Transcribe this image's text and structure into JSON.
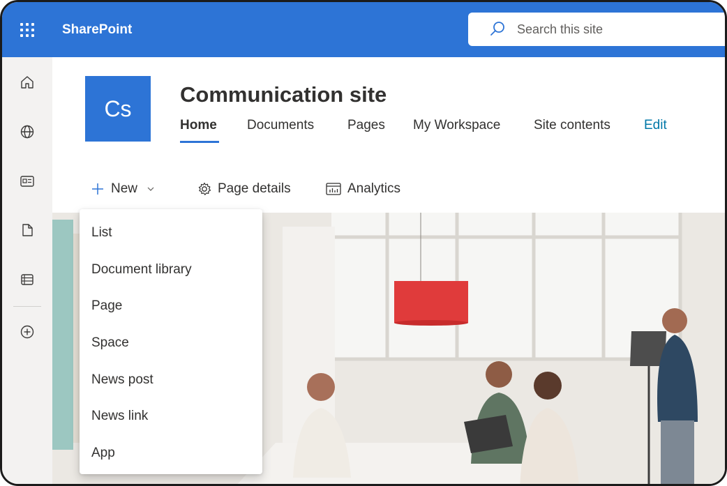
{
  "suitebar": {
    "app_name": "SharePoint",
    "search_placeholder": "Search this site",
    "color": "#2d74d6"
  },
  "rail": {
    "items": [
      {
        "icon": "home-icon"
      },
      {
        "icon": "globe-icon"
      },
      {
        "icon": "news-icon"
      },
      {
        "icon": "document-icon"
      },
      {
        "icon": "lists-icon"
      },
      {
        "icon": "add-circle-icon"
      }
    ]
  },
  "site": {
    "logo_text": "Cs",
    "title": "Communication site",
    "nav": [
      {
        "label": "Home",
        "active": true
      },
      {
        "label": "Documents"
      },
      {
        "label": "Pages"
      },
      {
        "label": "My Workspace"
      },
      {
        "label": "Site contents"
      },
      {
        "label": "Edit"
      }
    ]
  },
  "commands": {
    "new_label": "New",
    "page_details_label": "Page details",
    "analytics_label": "Analytics"
  },
  "new_menu": {
    "items": [
      {
        "label": "List"
      },
      {
        "label": "Document library"
      },
      {
        "label": "Page"
      },
      {
        "label": "Space"
      },
      {
        "label": "News post"
      },
      {
        "label": "News link"
      },
      {
        "label": "App"
      }
    ]
  }
}
